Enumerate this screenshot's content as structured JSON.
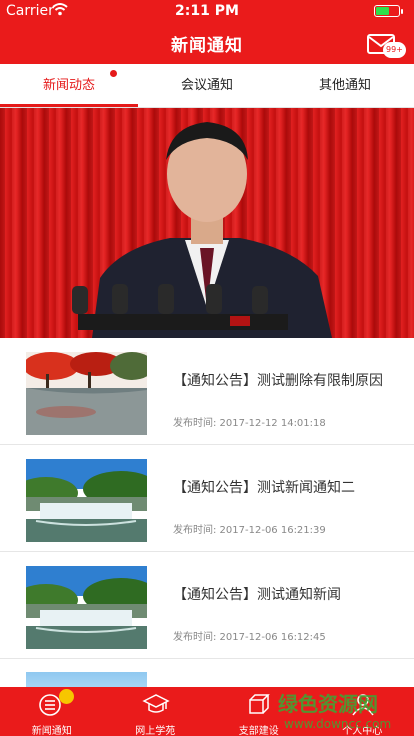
{
  "status_bar": {
    "carrier": "Carrier",
    "time": "2:11 PM"
  },
  "nav": {
    "title": "新闻通知",
    "badge": "99+"
  },
  "tabs": [
    {
      "label": "新闻动态",
      "active": true
    },
    {
      "label": "会议通知",
      "active": false
    },
    {
      "label": "其他通知",
      "active": false
    }
  ],
  "news": [
    {
      "title": "【通知公告】测试删除有限制原因",
      "time": "发布时间: 2017-12-12 14:01:18"
    },
    {
      "title": "【通知公告】测试新闻通知二",
      "time": "发布时间: 2017-12-06 16:21:39"
    },
    {
      "title": "【通知公告】测试通知新闻",
      "time": "发布时间: 2017-12-06 16:12:45"
    }
  ],
  "tabbar": [
    {
      "label": "新闻通知",
      "icon": "news-list-icon"
    },
    {
      "label": "网上学苑",
      "icon": "graduation-cap-icon"
    },
    {
      "label": "支部建设",
      "icon": "cube-icon"
    },
    {
      "label": "个人中心",
      "icon": "person-icon"
    }
  ],
  "watermark": {
    "text": "绿色资源网",
    "url": "www.downcc.com"
  },
  "colors": {
    "brand_red": "#ea1b1b",
    "tab_active": "#e51a1a",
    "notification": "#f7c600"
  }
}
